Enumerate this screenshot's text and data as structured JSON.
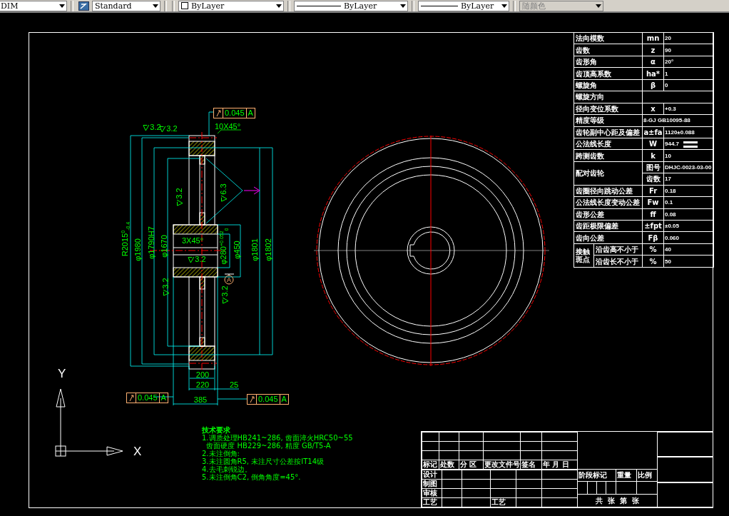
{
  "toolbar": {
    "layer": "DIM",
    "text_style": "Standard",
    "color_setting": "ByLayer",
    "linetype": "ByLayer",
    "lineweight": "ByLayer",
    "plot_style": "随颜色",
    "plot_style_disabled": true
  },
  "section_view": {
    "annotations": [
      {
        "kind": "roughness",
        "text": "3.2"
      },
      {
        "kind": "roughness",
        "text": "3.2"
      },
      {
        "kind": "dimension",
        "text": "10X45°"
      },
      {
        "kind": "dimension",
        "text": "R2015$^{0}$$_{-0.4}$"
      },
      {
        "kind": "dimension",
        "text": "φ1980"
      },
      {
        "kind": "dimension",
        "text": "φ1790H7"
      },
      {
        "kind": "dimension",
        "text": "φ1670"
      },
      {
        "kind": "dimension",
        "text": "φ1801"
      },
      {
        "kind": "dimension",
        "text": "φ1802"
      },
      {
        "kind": "dimension",
        "text": "3X45°"
      },
      {
        "kind": "dimension",
        "text": "φ280$^{+0.052}$$_{0}$"
      },
      {
        "kind": "dimension",
        "text": "φ450"
      },
      {
        "kind": "roughness",
        "text": "3.2"
      },
      {
        "kind": "roughness",
        "text": "6.3"
      },
      {
        "kind": "roughness",
        "text": "3.2"
      },
      {
        "kind": "roughness",
        "text": "3.2"
      },
      {
        "kind": "roughness",
        "text": "3.2"
      },
      {
        "kind": "dimension",
        "text": "200"
      },
      {
        "kind": "dimension",
        "text": "220"
      },
      {
        "kind": "dimension",
        "text": "25"
      },
      {
        "kind": "dimension",
        "text": "385"
      }
    ],
    "tolerance_frames": [
      {
        "value": "0.045",
        "datum": "A"
      },
      {
        "value": "0.045",
        "datum": "A"
      },
      {
        "value": "0.045",
        "datum": "A"
      }
    ],
    "datum": "A"
  },
  "axes": {
    "y_label": "Y",
    "x_label": "X"
  },
  "technical_notes": {
    "title": "技术要求",
    "lines": [
      "1.调质处理HB241~286, 齿面淬火HRC50~55",
      "  齿面硬度 HB229~286, 精度 GB/T5-A",
      "2.未注倒角:",
      "3.未注圆角R5, 未注尺寸公差按IT14级",
      "4.去毛刺锐边。",
      "5.未注倒角C2, 倒角角度=45°."
    ]
  },
  "parameter_table": {
    "rows": [
      {
        "kind": "single",
        "name": "法向模数",
        "symbol": "mn",
        "value": "20"
      },
      {
        "kind": "single",
        "name": "齿数",
        "symbol": "z",
        "value": "90"
      },
      {
        "kind": "single",
        "name": "齿形角",
        "symbol": "α",
        "value": "20°"
      },
      {
        "kind": "single",
        "name": "齿顶高系数",
        "symbol": "ha*",
        "value": "1"
      },
      {
        "kind": "single",
        "name": "螺旋角",
        "symbol": "β",
        "value": "0"
      },
      {
        "kind": "single",
        "name": "螺旋方向"
      },
      {
        "kind": "single",
        "name": "径向变位系数",
        "symbol": "x",
        "value": "+0.3"
      },
      {
        "kind": "single",
        "name": "精度等级",
        "value": "8-GJ GB10095-88"
      },
      {
        "kind": "single",
        "name": "齿轮副中心距及偏差",
        "symbol": "a±fa",
        "value": "1120±0.088"
      },
      {
        "kind": "single",
        "name": "公法线长度",
        "symbol": "W",
        "value": "944.7"
      },
      {
        "kind": "single",
        "name": "跨测齿数",
        "symbol": "k",
        "value": "10"
      },
      {
        "kind": "group",
        "name": "配对齿轮",
        "subrows": [
          {
            "symbol": "图号",
            "value": "DHJC-0023-03-00"
          },
          {
            "symbol": "齿数",
            "value": "17"
          }
        ]
      },
      {
        "kind": "single",
        "name": "齿圈径向跳动公差",
        "symbol": "Fr",
        "value": "0.18"
      },
      {
        "kind": "single",
        "name": "公法线长度变动公差",
        "symbol": "Fw",
        "value": "0.1"
      },
      {
        "kind": "single",
        "name": "齿形公差",
        "symbol": "ff",
        "value": "0.08"
      },
      {
        "kind": "single",
        "name": "齿距极限偏差",
        "symbol": "±fpt",
        "value": "±0.05"
      },
      {
        "kind": "single",
        "name": "齿向公差",
        "symbol": "Fβ",
        "value": "0.060"
      },
      {
        "kind": "group",
        "name": "接触斑点",
        "subrows": [
          {
            "name": "沿齿高不小于",
            "symbol": "%",
            "value": "40"
          },
          {
            "name": "沿齿长不小于",
            "symbol": "%",
            "value": "50"
          }
        ]
      }
    ]
  },
  "title_block": {
    "revision_headers": [
      "标记",
      "处数",
      "分 区",
      "更改文件号",
      "签名",
      "年 月 日"
    ],
    "roles": [
      "设计",
      "制图",
      "审核",
      "工艺"
    ],
    "extra_label": "工艺",
    "stage_mark": "阶段标记",
    "weight": "重量",
    "scale": "比例",
    "sheet_text": "共  张  第  张"
  }
}
